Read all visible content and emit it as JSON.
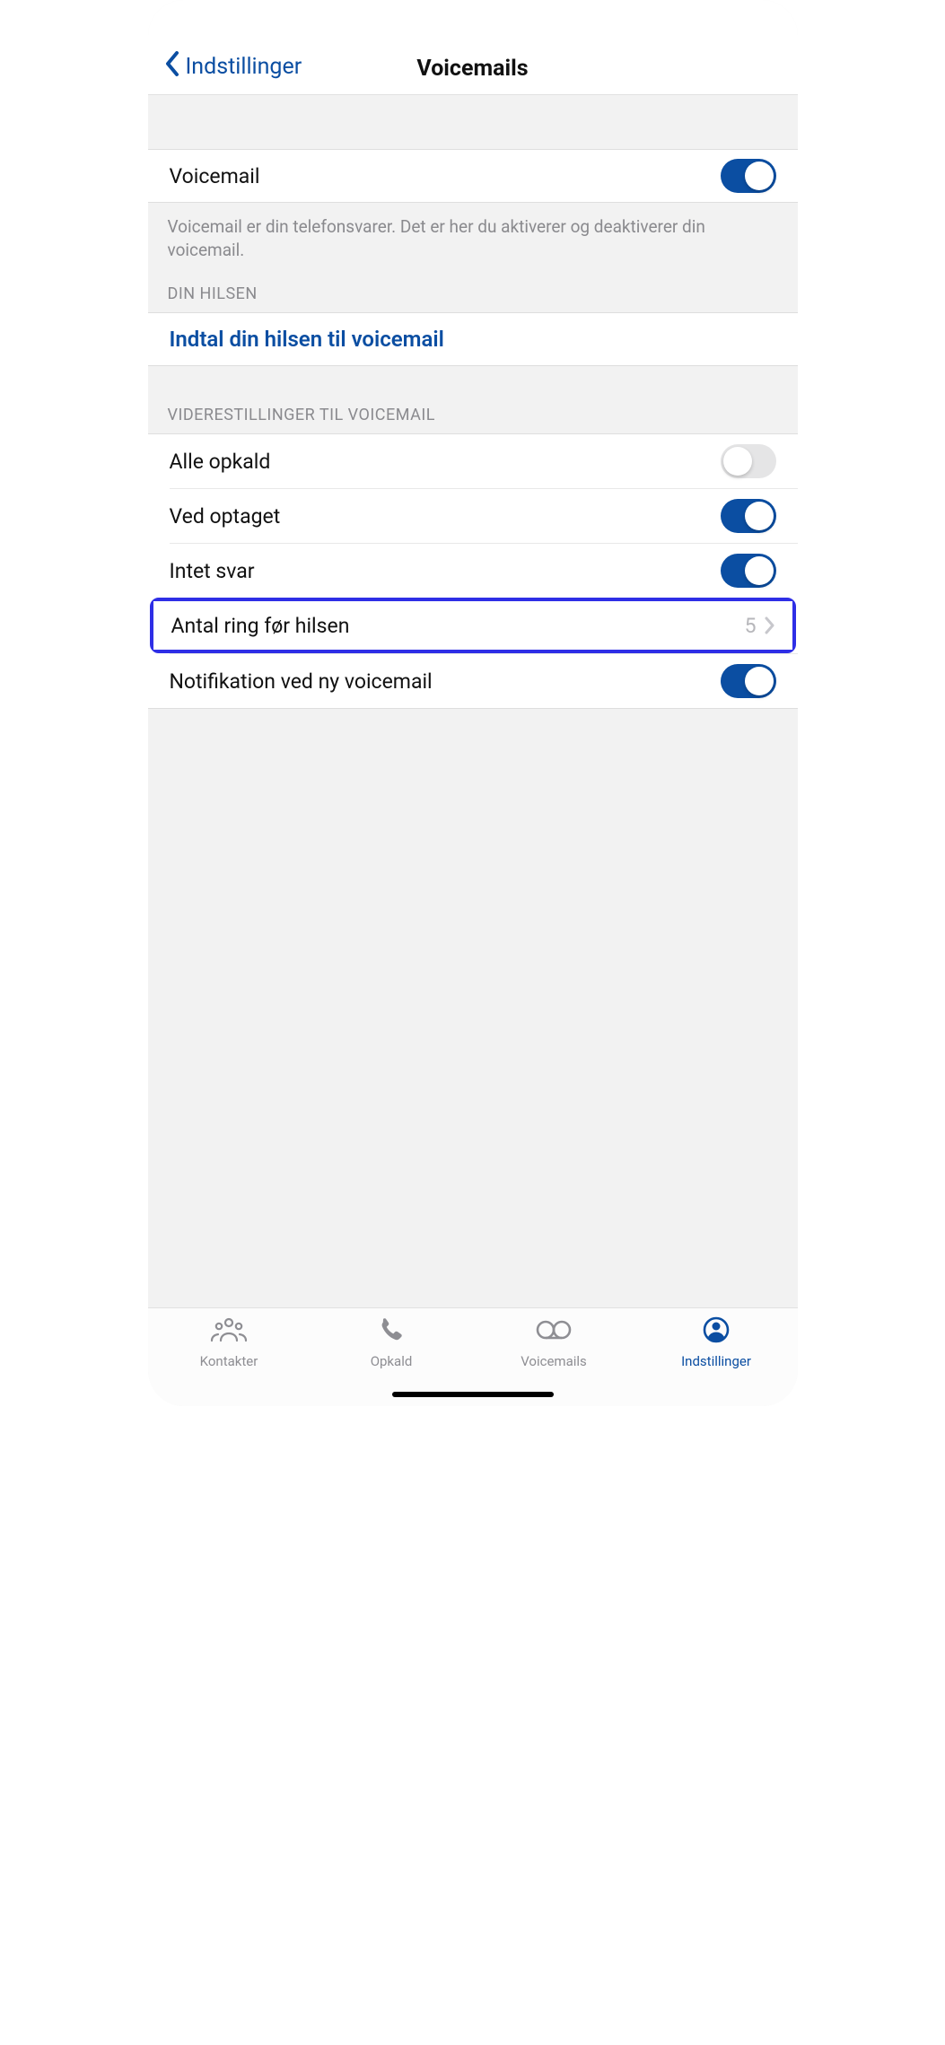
{
  "navbar": {
    "back_label": "Indstillinger",
    "title": "Voicemails"
  },
  "voicemail_toggle": {
    "label": "Voicemail",
    "on": true
  },
  "voicemail_note": "Voicemail er din telefonsvarer. Det er her du aktiverer og deaktiverer din voicemail.",
  "greeting_section_header": "DIN HILSEN",
  "greeting_link": "Indtal din hilsen til voicemail",
  "forward_section_header": "VIDERESTILLINGER TIL VOICEMAIL",
  "rows": {
    "all_calls": {
      "label": "Alle opkald",
      "on": false
    },
    "busy": {
      "label": "Ved optaget",
      "on": true
    },
    "no_answer": {
      "label": "Intet svar",
      "on": true
    },
    "rings": {
      "label": "Antal ring før hilsen",
      "value": "5"
    },
    "notify": {
      "label": "Notifikation ved ny voicemail",
      "on": true
    }
  },
  "tabs": {
    "contacts": "Kontakter",
    "calls": "Opkald",
    "voicemails": "Voicemails",
    "settings": "Indstillinger"
  }
}
